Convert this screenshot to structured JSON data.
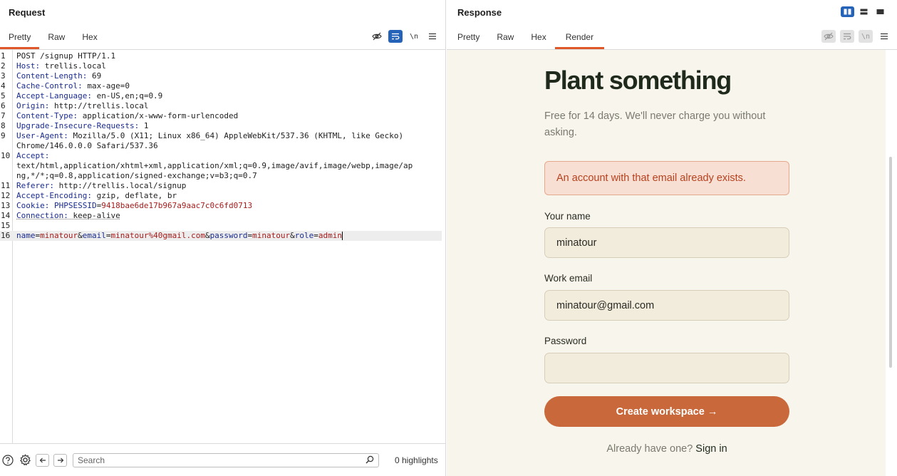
{
  "request": {
    "title": "Request",
    "tabs": [
      "Pretty",
      "Raw",
      "Hex"
    ],
    "active_tab": "Pretty",
    "tools": {
      "newline_label": "\\n"
    },
    "lines": [
      {
        "n": "1",
        "type": "plain",
        "text": "POST /signup HTTP/1.1"
      },
      {
        "n": "2",
        "type": "header",
        "key": "Host",
        "value": " trellis.local"
      },
      {
        "n": "3",
        "type": "header",
        "key": "Content-Length",
        "value": " 69"
      },
      {
        "n": "4",
        "type": "header",
        "key": "Cache-Control",
        "value": " max-age=0"
      },
      {
        "n": "5",
        "type": "header",
        "key": "Accept-Language",
        "value": " en-US,en;q=0.9"
      },
      {
        "n": "6",
        "type": "header",
        "key": "Origin",
        "value": " http://trellis.local"
      },
      {
        "n": "7",
        "type": "header",
        "key": "Content-Type",
        "value": " application/x-www-form-urlencoded"
      },
      {
        "n": "8",
        "type": "header",
        "key": "Upgrade-Insecure-Requests",
        "value": " 1"
      },
      {
        "n": "9",
        "type": "header",
        "key": "User-Agent",
        "value": " Mozilla/5.0 (X11; Linux x86_64) AppleWebKit/537.36 (KHTML, like Gecko)"
      },
      {
        "n": "",
        "type": "plain",
        "text": "Chrome/146.0.0.0 Safari/537.36"
      },
      {
        "n": "10",
        "type": "header",
        "key": "Accept",
        "value": ""
      },
      {
        "n": "",
        "type": "plain",
        "text": "text/html,application/xhtml+xml,application/xml;q=0.9,image/avif,image/webp,image/ap"
      },
      {
        "n": "",
        "type": "plain",
        "text": "ng,*/*;q=0.8,application/signed-exchange;v=b3;q=0.7"
      },
      {
        "n": "11",
        "type": "header",
        "key": "Referer",
        "value": " http://trellis.local/signup"
      },
      {
        "n": "12",
        "type": "header",
        "key": "Accept-Encoding",
        "value": " gzip, deflate, br"
      },
      {
        "n": "13",
        "type": "cookie",
        "key": "Cookie",
        "ckey": "PHPSESSID",
        "cval": "9418bae6de17b967a9aac7c0c6fd0713"
      },
      {
        "n": "14",
        "type": "header",
        "key": "Connection",
        "value": " keep-alive",
        "wavy": true
      },
      {
        "n": "15",
        "type": "plain",
        "text": ""
      },
      {
        "n": "16",
        "type": "params",
        "current": true,
        "params": [
          {
            "k": "name",
            "v": "minatour"
          },
          {
            "k": "email",
            "v": "minatour%40gmail.com"
          },
          {
            "k": "password",
            "v": "minatour"
          },
          {
            "k": "role",
            "v": "admin"
          }
        ]
      }
    ],
    "footer": {
      "search_placeholder": "Search",
      "highlights": "0 highlights"
    }
  },
  "response": {
    "title": "Response",
    "tabs": [
      "Pretty",
      "Raw",
      "Hex",
      "Render"
    ],
    "active_tab": "Render",
    "tools": {
      "newline_label": "\\n"
    },
    "render": {
      "heading": "Plant something",
      "subtitle": "Free for 14 days. We'll never charge you without asking.",
      "alert": "An account with that email already exists.",
      "name_label": "Your name",
      "name_value": "minatour",
      "email_label": "Work email",
      "email_value": "minatour@gmail.com",
      "password_label": "Password",
      "password_value": "",
      "submit_label": "Create workspace →",
      "signin_prefix": "Already have one? ",
      "signin_link": "Sign in"
    }
  },
  "colors": {
    "accent_tab": "#e0582a",
    "tool_active": "#2563b8",
    "header_key": "#1a2b8f",
    "param_value": "#a61b1b",
    "render_bg": "#f8f6ec",
    "alert_bg": "#f8dfd3",
    "alert_text": "#b7411f",
    "button": "#c9683a",
    "heading": "#1f2a1d"
  },
  "icons": {
    "request_tools": [
      "eye-slash-icon",
      "wrap-icon",
      "newline-icon",
      "menu-icon"
    ],
    "response_tools": [
      "eye-slash-icon",
      "wrap-icon",
      "newline-icon",
      "menu-icon"
    ],
    "footer": [
      "help-icon",
      "gear-icon",
      "back-arrow-icon",
      "forward-arrow-icon",
      "search-icon"
    ],
    "layout": [
      "split-columns-icon",
      "split-rows-icon",
      "single-pane-icon"
    ]
  }
}
